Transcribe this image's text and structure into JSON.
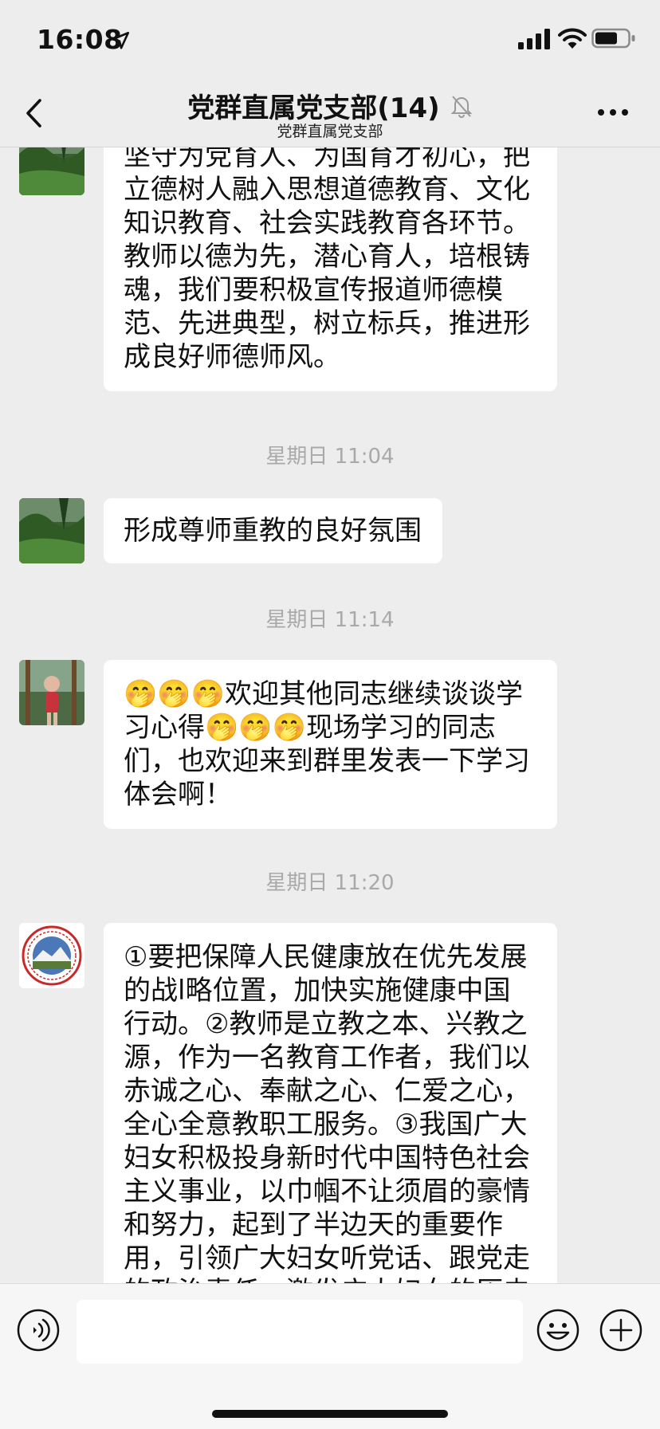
{
  "status_bar": {
    "time": "16:08"
  },
  "nav": {
    "title": "党群直属党支部(14)",
    "subtitle": "党群直属党支部"
  },
  "messages": [
    {
      "type": "text",
      "text": "坚守为党育人、为国育才初心，把立德树人融入思想道德教育、文化知识教育、社会实践教育各环节。教师以德为先，潜心育人，培根铸魂，我们要积极宣传报道师德模范、先进典型，树立标兵，推进形成良好师德师风。"
    },
    {
      "type": "timestamp",
      "text": "星期日 11:04"
    },
    {
      "type": "text",
      "text": "形成尊师重教的良好氛围"
    },
    {
      "type": "timestamp",
      "text": "星期日 11:14"
    },
    {
      "type": "text",
      "text": "🤭🤭🤭欢迎其他同志继续谈谈学习心得🤭🤭🤭现场学习的同志们，也欢迎来到群里发表一下学习体会啊！"
    },
    {
      "type": "timestamp",
      "text": "星期日 11:20"
    },
    {
      "type": "text",
      "text": "①要把保障人民健康放在优先发展的战l略位置，加快实施健康中国行动。②教师是立教之本、兴教之源，作为一名教育工作者，我们以赤诚之心、奉献之心、仁爱之心，全心全意教职工服务。③我国广大妇女积极投身新时代中国特色社会主义事业，以巾帼不让须眉的豪情和努力，起到了半边天的重要作用，引领广大妇女听党话、跟党走的政治责任，激发广大妇女的历史"
    }
  ],
  "input": {
    "placeholder": ""
  },
  "icons": {
    "location": "location-arrow-icon",
    "signal": "cellular-signal-icon",
    "wifi": "wifi-icon",
    "battery": "battery-icon",
    "back": "chevron-left-icon",
    "mute": "bell-muted-icon",
    "more": "more-dots-icon",
    "voice": "voice-icon",
    "emoji": "smiley-icon",
    "plus": "plus-icon"
  },
  "colors": {
    "background": "#ededed",
    "bubble": "#ffffff",
    "timestamp": "#a9a9a9",
    "input_bar": "#f6f6f6"
  }
}
